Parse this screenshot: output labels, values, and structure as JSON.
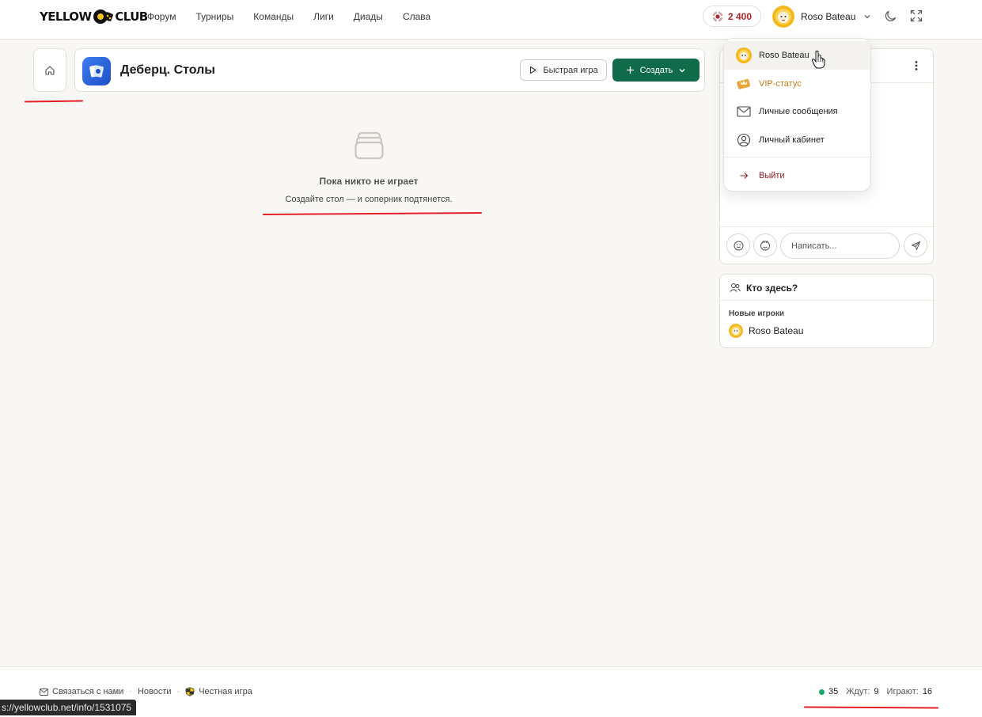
{
  "topbar": {
    "logo_left": "YELLOW",
    "logo_right": "CLUB",
    "nav": [
      "Форум",
      "Турниры",
      "Команды",
      "Лиги",
      "Диады",
      "Слава"
    ],
    "balance": "2 400",
    "user_name": "Roso Bateau",
    "icons": [
      "casino-chip-icon",
      "chevron-down-icon",
      "moon-icon",
      "fullscreen-icon"
    ]
  },
  "header": {
    "title": "Деберц. Столы",
    "quick_game": "Быстрая игра",
    "create": "Создать"
  },
  "empty_state": {
    "title": "Пока никто не играет",
    "subtitle": "Создайте стол — и соперник подтянется."
  },
  "user_menu": {
    "profile": "Roso Bateau",
    "vip": "VIP-статус",
    "messages": "Личные сообщения",
    "cabinet": "Личный кабинет",
    "logout": "Выйти"
  },
  "chat": {
    "placeholder": "Написать..."
  },
  "who_here": {
    "title": "Кто здесь?",
    "section": "Новые игроки",
    "players": [
      "Roso Bateau"
    ]
  },
  "footer": {
    "contact": "Связаться с нами",
    "news": "Новости",
    "fair": "Честная игра",
    "online": "35",
    "waiting_label": "Ждут:",
    "waiting": "9",
    "playing_label": "Играют:",
    "playing": "16"
  },
  "status_bar": {
    "url": "s://yellowclub.net/info/1531075"
  },
  "colors": {
    "accent_green": "#0f6b4a",
    "balance_red": "#b3262b",
    "annotation_red": "#e3202a",
    "online_dot": "#19a86a",
    "vip_orange": "#c47a1b"
  }
}
